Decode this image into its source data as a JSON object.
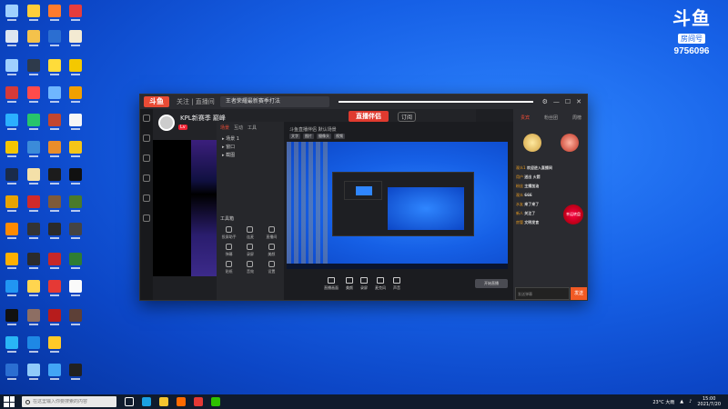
{
  "brand": {
    "logo_text": "斗鱼",
    "badge": "房间号",
    "room_number": "9756096"
  },
  "app": {
    "logo": "斗鱼",
    "nav_label": "关注 | 直播间",
    "tab_title": "王者荣耀最新赛季打法",
    "room": {
      "title": "KPL新赛季 巅峰",
      "badge": "Lv",
      "studio_banner": "直播伴侣",
      "subscribe": "订阅"
    },
    "panel": {
      "tabs": [
        "场景",
        "互动",
        "工具"
      ],
      "tree": [
        "▸ 场景 1",
        "▸ 窗口",
        "▸ 截图"
      ],
      "tools_title": "工具箱",
      "tools": [
        "投屏助手",
        "连麦",
        "直播间",
        "弹幕",
        "录屏",
        "美颜",
        "贴纸",
        "音效",
        "设置"
      ]
    },
    "preview": {
      "title": "斗鱼直播伴侣 默认场景",
      "chips": [
        "文字",
        "图片",
        "摄像头",
        "视频"
      ],
      "controls": [
        "直播画面",
        "美颜",
        "录屏",
        "麦克风",
        "声音"
      ],
      "live_button": "开始直播"
    },
    "chat": {
      "tabs": [
        "贵宾",
        "粉丝团",
        "周榜"
      ],
      "messages": [
        {
          "user": "观众1",
          "text": "欢迎进入直播间"
        },
        {
          "user": "用户",
          "text": "送出 火箭"
        },
        {
          "user": "粉丝",
          "text": "主播加油"
        },
        {
          "user": "观众",
          "text": "666"
        },
        {
          "user": "水友",
          "text": "来了来了"
        },
        {
          "user": "新人",
          "text": "关注了"
        },
        {
          "user": "房管",
          "text": "文明发言"
        }
      ],
      "lucky": "幸运转盘",
      "input_placeholder": "发送弹幕",
      "send": "发送"
    }
  },
  "taskbar": {
    "search_placeholder": "在这里输入你要搜索的内容",
    "weather": "23°C 大雨",
    "time": "15:00",
    "date": "2021/7/20"
  }
}
